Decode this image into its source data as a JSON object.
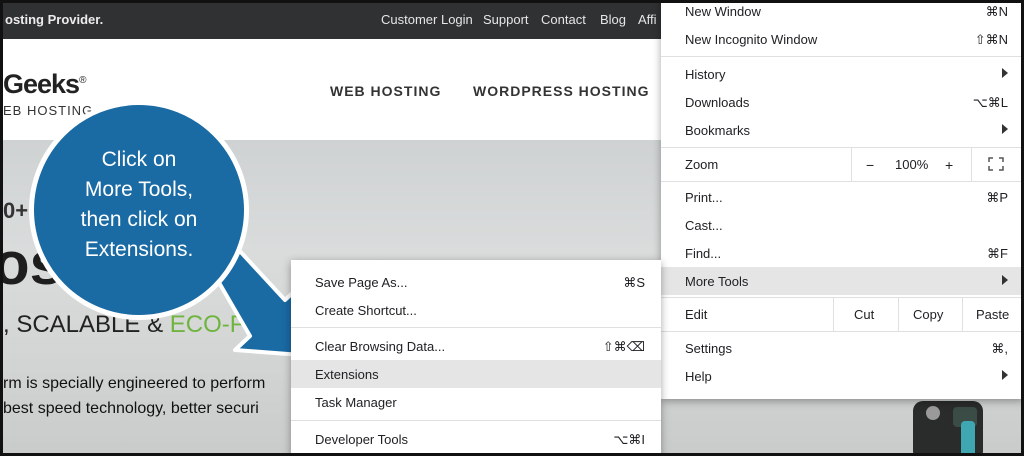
{
  "topbar": {
    "tagline": "osting Provider.",
    "links": [
      "Customer Login",
      "Support",
      "Contact",
      "Blog",
      "Affi"
    ]
  },
  "header": {
    "logo": "Geeks",
    "logo_mark": "®",
    "logo_sub": "EB HOSTING",
    "nav": [
      "WEB HOSTING",
      "WORDPRESS HOSTING"
    ]
  },
  "hero": {
    "small": "0+",
    "big": "os",
    "tagline": ", SCALABLE & ",
    "tagline_green": "ECO-F",
    "p1": "rm is specially engineered to perform",
    "p2": " best speed technology, better securi"
  },
  "callout": {
    "lines": [
      "Click on",
      "More Tools,",
      "then click on",
      "Extensions."
    ]
  },
  "chrome_menu": {
    "new_window": "New Window",
    "new_window_sc": "⌘N",
    "incognito": "New Incognito Window",
    "incognito_sc": "⇧⌘N",
    "history": "History",
    "downloads": "Downloads",
    "downloads_sc": "⌥⌘L",
    "bookmarks": "Bookmarks",
    "zoom": "Zoom",
    "zoom_minus": "−",
    "zoom_value": "100%",
    "zoom_plus": "+",
    "print": "Print...",
    "print_sc": "⌘P",
    "cast": "Cast...",
    "find": "Find...",
    "find_sc": "⌘F",
    "more_tools": "More Tools",
    "edit": "Edit",
    "cut": "Cut",
    "copy": "Copy",
    "paste": "Paste",
    "settings": "Settings",
    "settings_sc": "⌘,",
    "help": "Help"
  },
  "submenu": {
    "save_page": "Save Page As...",
    "save_page_sc": "⌘S",
    "create_shortcut": "Create Shortcut...",
    "clear_data": "Clear Browsing Data...",
    "clear_data_sc": "⇧⌘⌫",
    "extensions": "Extensions",
    "task_manager": "Task Manager",
    "dev_tools": "Developer Tools",
    "dev_tools_sc": "⌥⌘I"
  },
  "colors": {
    "callout": "#1a6aa3",
    "highlight": "#e5e5e5",
    "eco_green": "#6fb43f"
  }
}
